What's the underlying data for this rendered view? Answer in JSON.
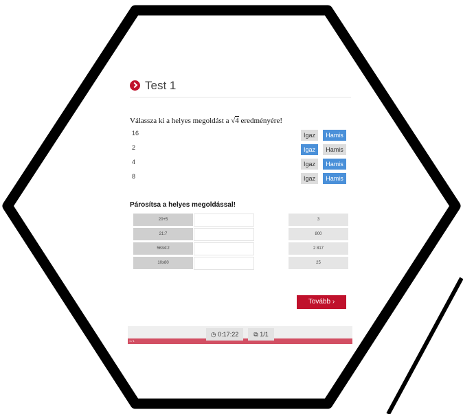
{
  "title": "Test 1",
  "question1": {
    "text_before": "Válassza ki a helyes megoldást a",
    "radicand": "4",
    "text_after": "eredményére!",
    "options": [
      {
        "label": "16",
        "true_label": "Igaz",
        "false_label": "Hamis",
        "selected": "Hamis"
      },
      {
        "label": "2",
        "true_label": "Igaz",
        "false_label": "Hamis",
        "selected": "Igaz"
      },
      {
        "label": "4",
        "true_label": "Igaz",
        "false_label": "Hamis",
        "selected": "Hamis"
      },
      {
        "label": "8",
        "true_label": "Igaz",
        "false_label": "Hamis",
        "selected": "Hamis"
      }
    ]
  },
  "question2": {
    "text": "Párosítsa a helyes megoldással!",
    "left": [
      "20+5",
      "21:7",
      "5634:2",
      "10x80"
    ],
    "right": [
      "3",
      "800",
      "2 817",
      "25"
    ]
  },
  "next_label": "Tovább",
  "footer": {
    "timer": "0:17:22",
    "pages": "1/1",
    "progress_text": "1 / 1",
    "progress": 1.0
  },
  "colors": {
    "accent": "#c0112c",
    "selected": "#4a90d9",
    "progress": "#d24f63"
  }
}
